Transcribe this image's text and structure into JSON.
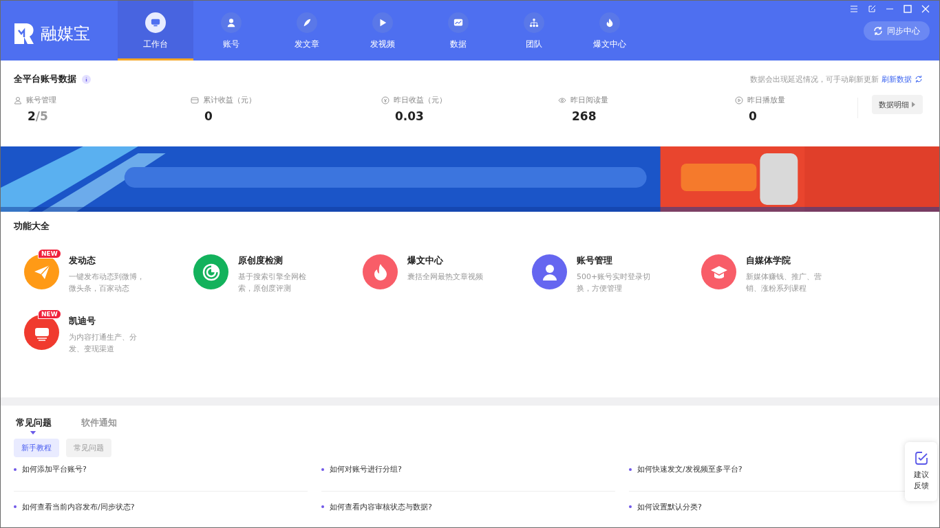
{
  "app": {
    "name": "融媒宝"
  },
  "nav": [
    {
      "label": "工作台",
      "selected": true
    },
    {
      "label": "账号",
      "selected": false
    },
    {
      "label": "发文章",
      "selected": false
    },
    {
      "label": "发视频",
      "selected": false
    },
    {
      "label": "数据",
      "selected": false
    },
    {
      "label": "团队",
      "selected": false
    },
    {
      "label": "爆文中心",
      "selected": false
    }
  ],
  "sync_button": "同步中心",
  "stats": {
    "title": "全平台账号数据",
    "notice": "数据会出现延迟情况，可手动刷新更新",
    "refresh": "刷新数据",
    "detail_button": "数据明细",
    "items": [
      {
        "label": "账号管理",
        "value": "2",
        "total": "/5"
      },
      {
        "label": "累计收益（元）",
        "value": "0"
      },
      {
        "label": "昨日收益（元）",
        "value": "0.03"
      },
      {
        "label": "昨日阅读量",
        "value": "268"
      },
      {
        "label": "昨日播放量",
        "value": "0"
      }
    ]
  },
  "features": {
    "title": "功能大全",
    "items": [
      {
        "color": "#ff9a16",
        "name": "发动态",
        "desc": "一键发布动态到微博，微头条，百家动态",
        "badge": "NEW"
      },
      {
        "color": "#13b25c",
        "name": "原创度检测",
        "desc": "基于搜索引擎全网检索，原创度评测"
      },
      {
        "color": "#f85d68",
        "name": "爆文中心",
        "desc": "囊括全网最热文章视频"
      },
      {
        "color": "#6566f0",
        "name": "账号管理",
        "desc": "500+账号实时登录切换，方便管理"
      },
      {
        "color": "#f85d68",
        "name": "自媒体学院",
        "desc": "新媒体赚钱、推广、营销、涨粉系列课程"
      },
      {
        "color": "#f03a2e",
        "name": "凯迪号",
        "desc": "为内容打通生产、分发、变现渠道",
        "badge": "NEW"
      }
    ]
  },
  "help": {
    "tabs": [
      {
        "label": "常见问题",
        "selected": true
      },
      {
        "label": "软件通知",
        "selected": false
      }
    ],
    "filters": [
      {
        "label": "新手教程",
        "selected": true
      },
      {
        "label": "常见问题",
        "selected": false
      }
    ],
    "questions": [
      "如何添加平台账号?",
      "如何对账号进行分组?",
      "如何快速发文/发视频至多平台?",
      "如何查看当前内容发布/同步状态?",
      "如何查看内容审核状态与数据?",
      "如何设置默认分类?"
    ]
  },
  "feedback": "建议反馈"
}
